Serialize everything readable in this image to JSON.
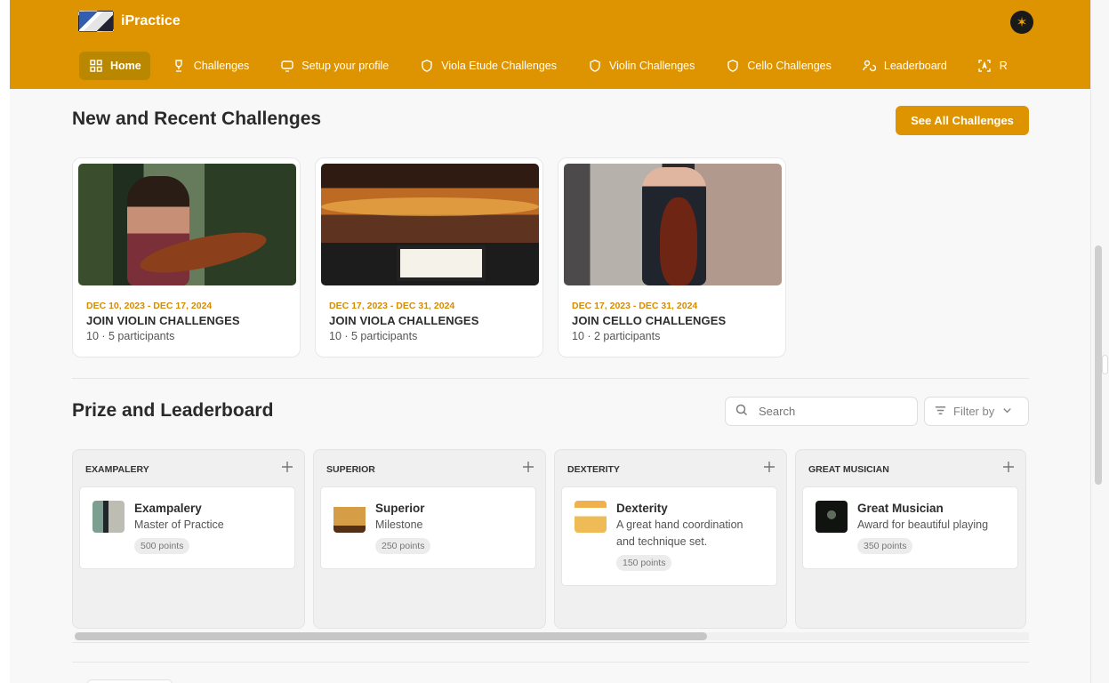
{
  "app": {
    "title": "iPractice"
  },
  "nav": {
    "items": [
      {
        "label": "Home",
        "icon": "grid-icon",
        "active": true
      },
      {
        "label": "Challenges",
        "icon": "trophy-icon"
      },
      {
        "label": "Setup your profile",
        "icon": "monitor-icon"
      },
      {
        "label": "Viola Etude Challenges",
        "icon": "shield-icon"
      },
      {
        "label": "Violin Challenges",
        "icon": "shield-icon"
      },
      {
        "label": "Cello Challenges",
        "icon": "shield-icon"
      },
      {
        "label": "Leaderboard",
        "icon": "users-icon"
      },
      {
        "label": "R",
        "icon": "scan-text-icon"
      }
    ]
  },
  "sections": {
    "new_recent_title": "New and Recent Challenges",
    "see_all_label": "See All Challenges",
    "prize_title": "Prize and Leaderboard"
  },
  "challenges": [
    {
      "date_range": "DEC 10, 2023 - DEC 17, 2024",
      "title": "JOIN VIOLIN CHALLENGES",
      "meta": "10 · 5 participants",
      "image": "violin-player-image"
    },
    {
      "date_range": "DEC 17, 2023 - DEC 31, 2024",
      "title": "JOIN VIOLA CHALLENGES",
      "meta": "10 · 5 participants",
      "image": "concert-hall-image"
    },
    {
      "date_range": "DEC 17, 2023 - DEC 31, 2024",
      "title": "JOIN CELLO CHALLENGES",
      "meta": "10 · 2 participants",
      "image": "cello-player-image"
    }
  ],
  "search": {
    "placeholder": "Search",
    "value": ""
  },
  "filter": {
    "label": "Filter by"
  },
  "leaderboard": {
    "columns": [
      {
        "header": "EXAMPALERY",
        "prize": {
          "name": "Exampalery",
          "description": "Master of Practice",
          "points": "500 points"
        }
      },
      {
        "header": "SUPERIOR",
        "prize": {
          "name": "Superior",
          "description": "Milestone",
          "points": "250 points"
        }
      },
      {
        "header": "DEXTERITY",
        "prize": {
          "name": "Dexterity",
          "description": "A great hand coordination and technique set.",
          "points": "150 points"
        }
      },
      {
        "header": "GREAT MUSICIAN",
        "prize": {
          "name": "Great Musician",
          "description": "Award for beautiful playing",
          "points": "350 points"
        }
      }
    ]
  },
  "colors": {
    "brand": "#de9300",
    "active_nav": "#b98700",
    "accent_text": "#d68c00",
    "surface": "#f8f8f8"
  },
  "icons": {
    "avatar": "moth-avatar-icon",
    "search": "search-icon",
    "filter": "filter-icon",
    "chevron": "chevron-down-icon",
    "add": "plus-icon"
  }
}
